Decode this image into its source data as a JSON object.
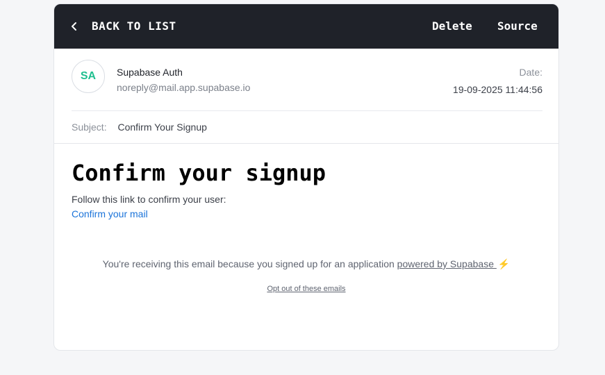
{
  "topbar": {
    "back_label": "BACK TO LIST",
    "delete_label": "Delete",
    "source_label": "Source"
  },
  "sender": {
    "initials": "SA",
    "name": "Supabase Auth",
    "email": "noreply@mail.app.supabase.io",
    "date_label": "Date:",
    "date_value": "19-09-2025 11:44:56"
  },
  "subject": {
    "label": "Subject:",
    "value": "Confirm Your Signup"
  },
  "email_body": {
    "headline": "Confirm your signup",
    "text": "Follow this link to confirm your user:",
    "link": "Confirm your mail",
    "footer_prefix": "You're receiving this email because you signed up for an application ",
    "footer_link": "powered by Supabase ",
    "footer_bolt": "⚡",
    "optout": "Opt out of these emails"
  },
  "colors": {
    "topbar_bg": "#1f2229",
    "avatar_text": "#1fbf8f",
    "link": "#1a73d9",
    "page_bg": "#f5f6f8"
  },
  "icons": {
    "back": "chevron-left-icon",
    "bolt": "lightning-icon"
  }
}
